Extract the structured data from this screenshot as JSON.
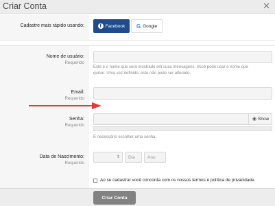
{
  "dialog": {
    "title": "Criar Conta",
    "close_label": "✕"
  },
  "social": {
    "label": "Cadastre mais rápido usando:",
    "facebook_label": "Facebook",
    "google_label": "Google"
  },
  "username": {
    "label": "Nome de usuário:",
    "required": "Requerido",
    "value": "",
    "hint_line1": "Este é o nome que será mostrado em suas mensagens. Você pode usar o nome que",
    "hint_line2": "quiser. Uma vez definido, este não pode ser alterado."
  },
  "email": {
    "label": "Email:",
    "required": "Requerido",
    "value": ""
  },
  "password": {
    "label": "Senha:",
    "required": "Requerido",
    "value": "",
    "show_label": "Show",
    "hint": "É necessário escolher uma senha."
  },
  "dob": {
    "label": "Data de Nascimento:",
    "required": "Requerido",
    "month_value": "",
    "day_placeholder": "Dia",
    "year_placeholder": "Ano"
  },
  "terms": {
    "text": "Ao se cadastrar você concorda com os nossos termos e política de privacidade."
  },
  "submit_label": "Criar Conta",
  "colors": {
    "facebook": "#204c8c",
    "annotation_arrow": "#e53935",
    "submit": "#828282"
  }
}
